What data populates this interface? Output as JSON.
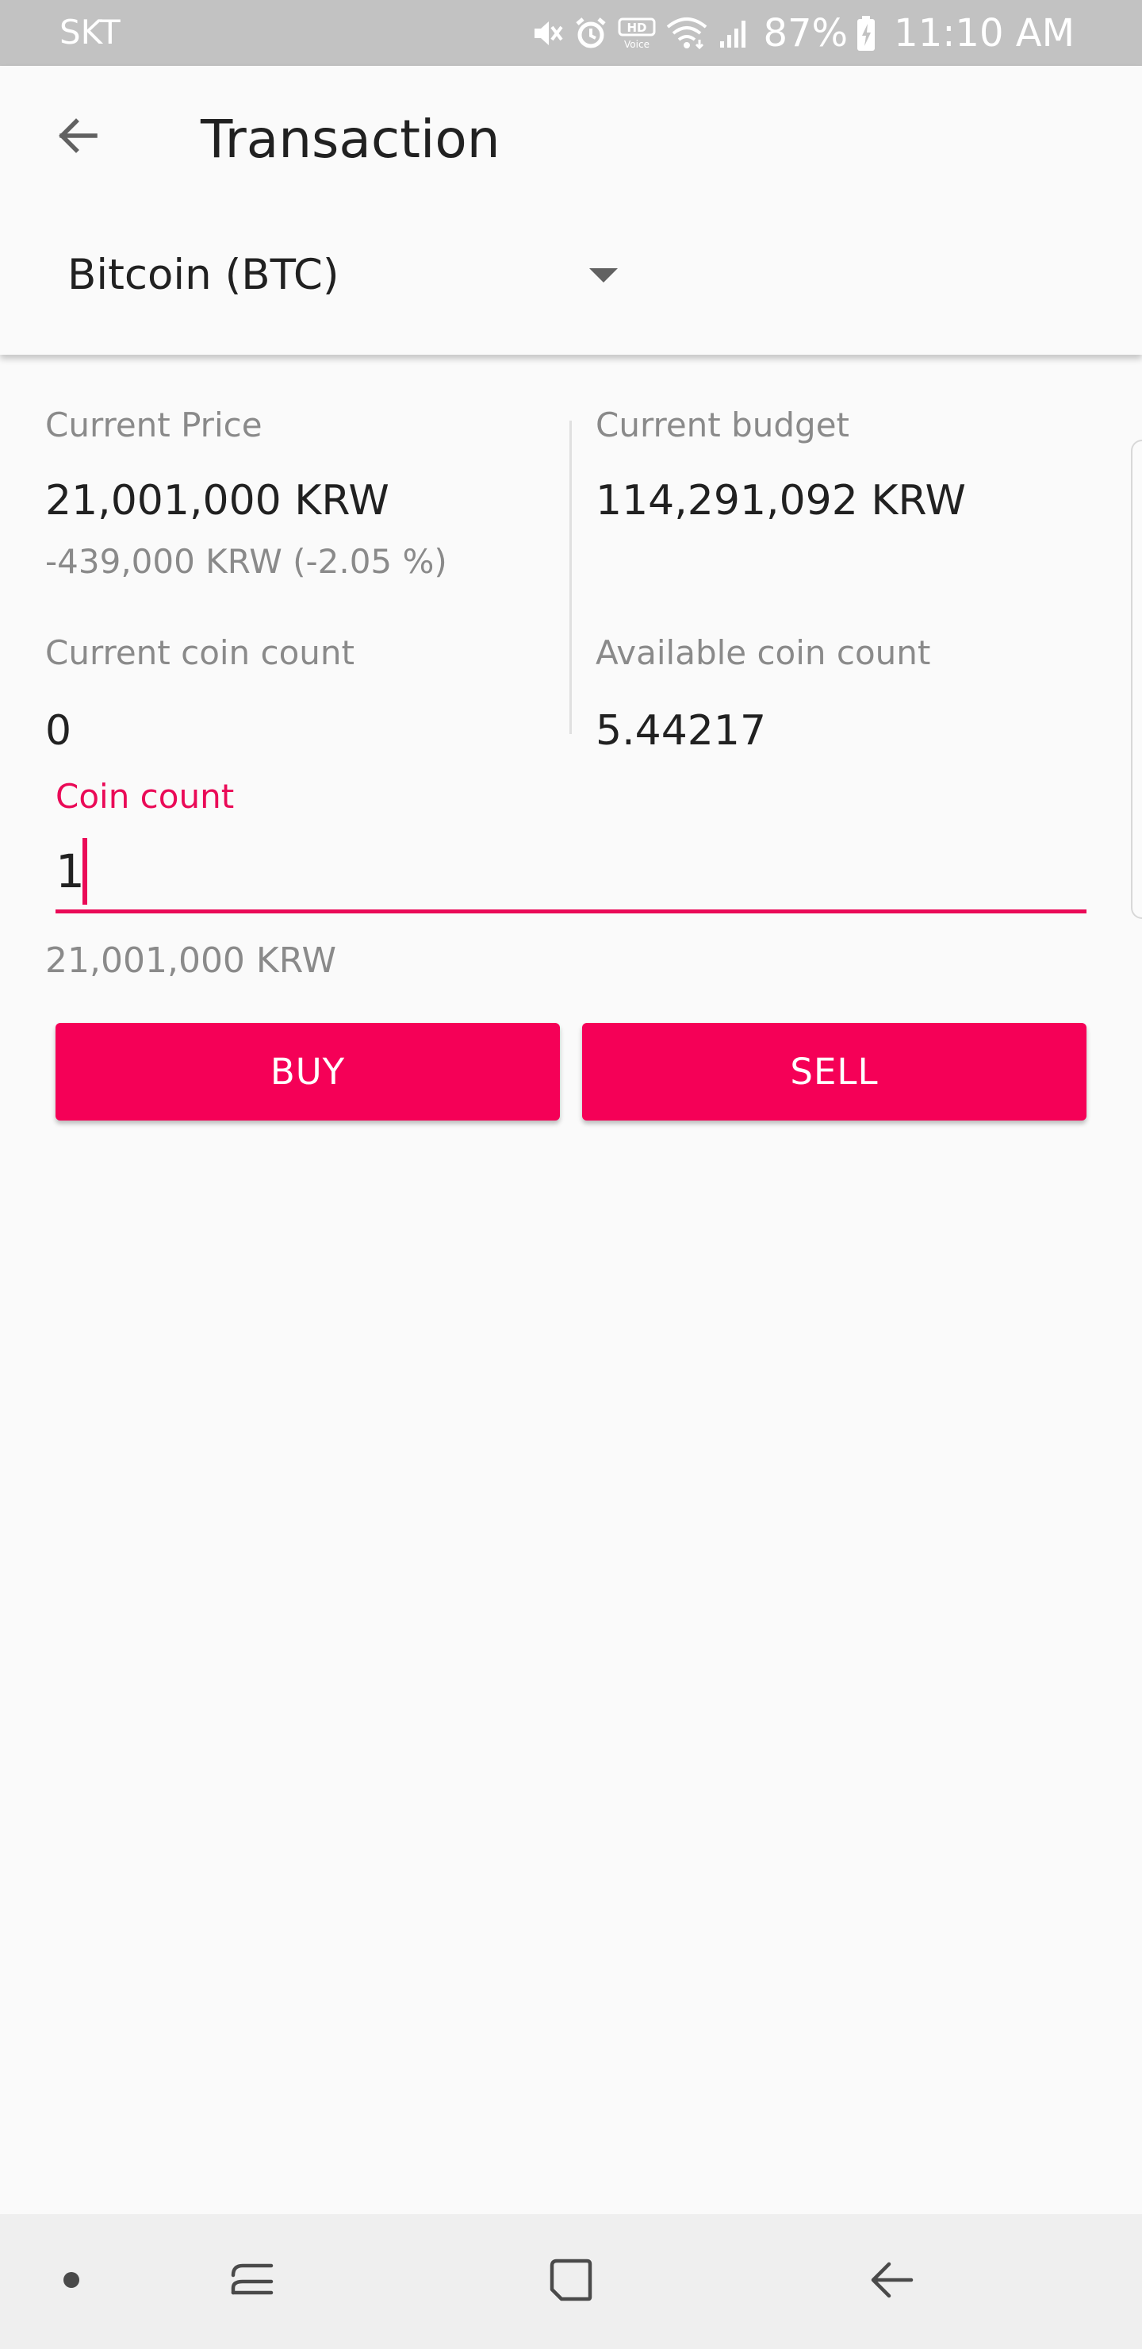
{
  "status_bar": {
    "carrier": "SKT",
    "battery": "87%",
    "time": "11:10 AM",
    "icons": [
      "mute-icon",
      "alarm-icon",
      "hd-voice-icon",
      "wifi-icon",
      "signal-icon",
      "battery-charging-icon"
    ]
  },
  "app_bar": {
    "title": "Transaction",
    "back_icon": "arrow-back-icon",
    "coin_selector": {
      "selected": "Bitcoin (BTC)",
      "icon": "dropdown-arrow-icon"
    }
  },
  "info": {
    "current_price": {
      "label": "Current Price",
      "value": "21,001,000 KRW",
      "change": "-439,000 KRW (-2.05 %)"
    },
    "current_budget": {
      "label": "Current budget",
      "value": "114,291,092 KRW"
    },
    "current_coin_count": {
      "label": "Current coin count",
      "value": "0"
    },
    "available_coin_count": {
      "label": "Available coin count",
      "value": "5.44217"
    }
  },
  "coin_count_field": {
    "label": "Coin count",
    "value": "1"
  },
  "total_price": "21,001,000 KRW",
  "buttons": {
    "buy": "BUY",
    "sell": "SELL"
  },
  "nav_bar": {
    "icons": [
      "dot-icon",
      "recent-apps-icon",
      "home-icon",
      "back-icon"
    ]
  },
  "colors": {
    "accent": "#f50057",
    "accent_text": "#ea0a57",
    "status_bar": "#c2c2c2",
    "background": "#fafafa"
  }
}
